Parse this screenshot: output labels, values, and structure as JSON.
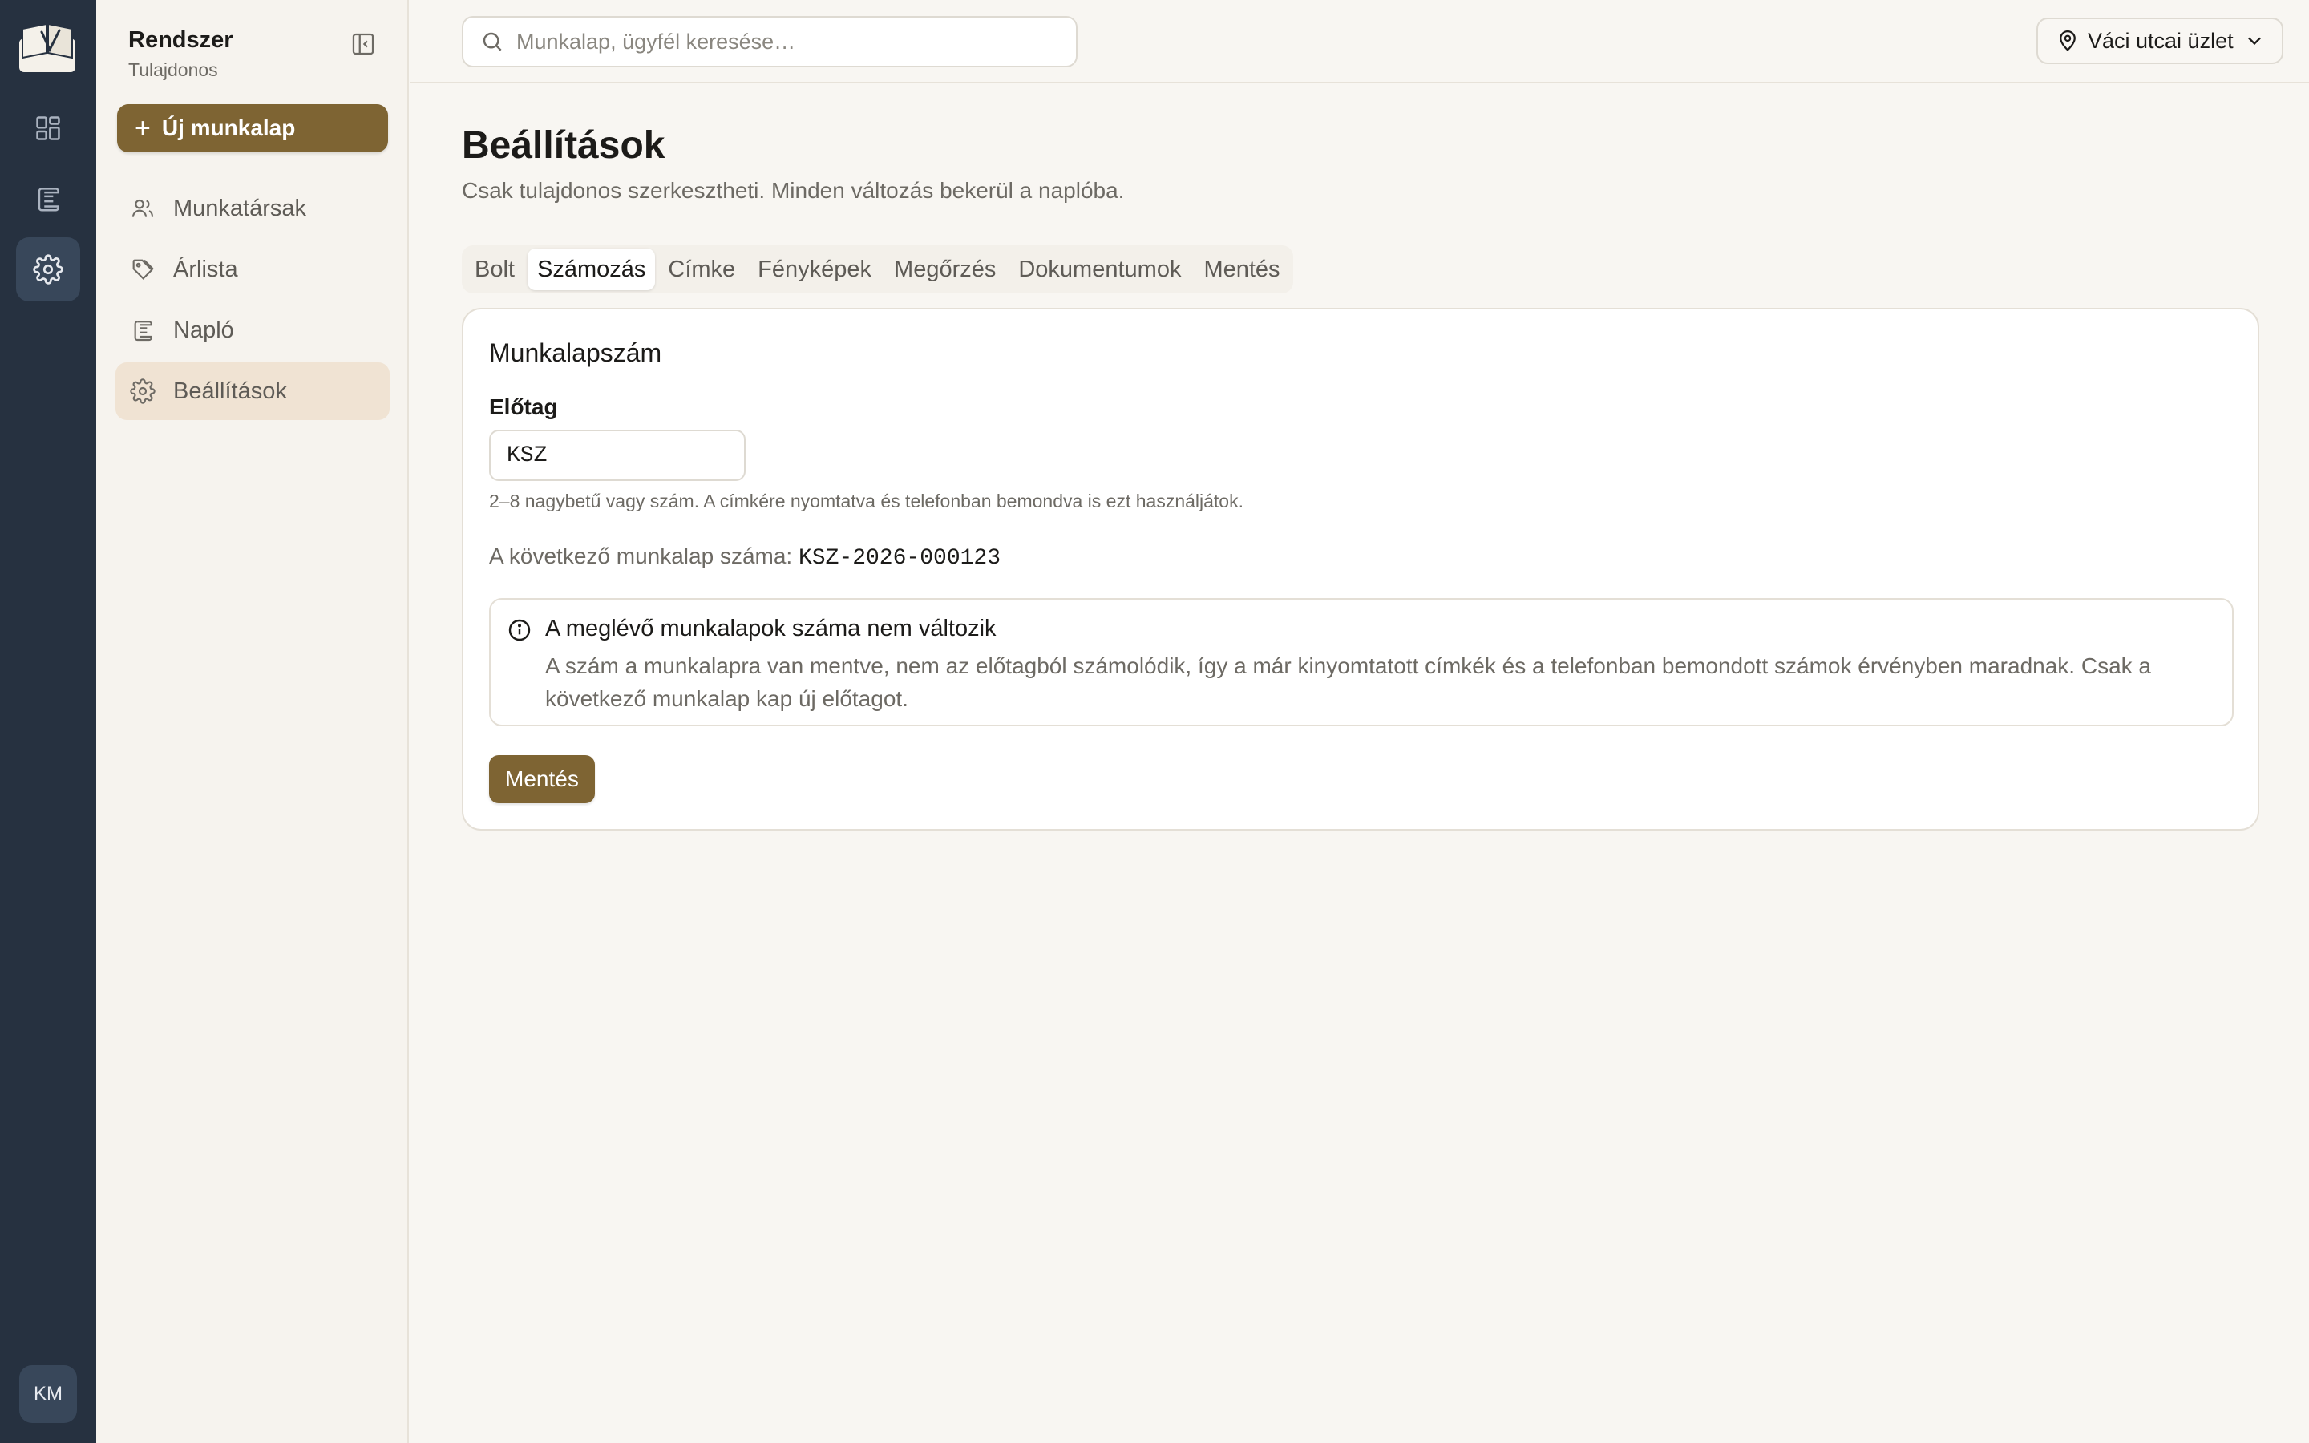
{
  "rail": {
    "items": [
      {
        "icon": "dashboard-icon",
        "active": false
      },
      {
        "icon": "log-scroll-icon",
        "active": false
      },
      {
        "icon": "gear-icon",
        "active": true
      }
    ],
    "avatar_initials": "KM"
  },
  "sidebar": {
    "org_name": "Rendszer",
    "org_role": "Tulajdonos",
    "new_button_label": "Új munkalap",
    "items": [
      {
        "label": "Munkatársak",
        "icon": "users-icon",
        "active": false
      },
      {
        "label": "Árlista",
        "icon": "tags-icon",
        "active": false
      },
      {
        "label": "Napló",
        "icon": "log-scroll-icon",
        "active": false
      },
      {
        "label": "Beállítások",
        "icon": "gear-icon",
        "active": true
      }
    ]
  },
  "topbar": {
    "search_placeholder": "Munkalap, ügyfél keresése…",
    "store_name": "Váci utcai üzlet"
  },
  "page": {
    "title": "Beállítások",
    "subtitle": "Csak tulajdonos szerkesztheti. Minden változás bekerül a naplóba."
  },
  "tabs": [
    {
      "label": "Bolt",
      "active": false
    },
    {
      "label": "Számozás",
      "active": true
    },
    {
      "label": "Címke",
      "active": false
    },
    {
      "label": "Fényképek",
      "active": false
    },
    {
      "label": "Megőrzés",
      "active": false
    },
    {
      "label": "Dokumentumok",
      "active": false
    },
    {
      "label": "Mentés",
      "active": false
    }
  ],
  "card": {
    "title": "Munkalapszám",
    "prefix_label": "Előtag",
    "prefix_value": "KSZ",
    "helper": "2–8 nagybetű vagy szám. A címkére nyomtatva és telefonban bemondva is ezt használjátok.",
    "next_label": "A következő munkalap száma:",
    "next_value": "KSZ-2026-000123",
    "alert_title": "A meglévő munkalapok száma nem változik",
    "alert_body": "A szám a munkalapra van mentve, nem az előtagból számolódik, így a már kinyomtatott címkék és a telefonban bemondott számok érvényben maradnak. Csak a következő munkalap kap új előtagot.",
    "save_label": "Mentés"
  },
  "colors": {
    "rail_bg": "#263140",
    "accent": "#7e6433",
    "active_nav": "#f0e3d3",
    "page_bg": "#f8f6f2"
  }
}
